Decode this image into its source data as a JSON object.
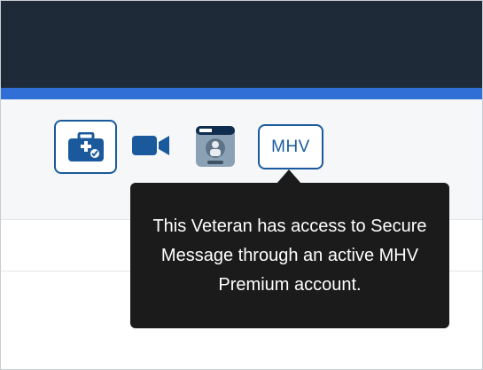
{
  "toolbar": {
    "icons": [
      "medical-kit-icon",
      "video-camera-icon",
      "veteran-id-card-icon"
    ],
    "mhv_label": "MHV"
  },
  "tooltip": {
    "text": "This Veteran has access to Secure Message through an active MHV Premium account."
  },
  "colors": {
    "header_bg": "#1f2a39",
    "accent_bar": "#2f6fd6",
    "icon_blue": "#1a5a9c",
    "tooltip_bg": "#1b1b1b"
  }
}
